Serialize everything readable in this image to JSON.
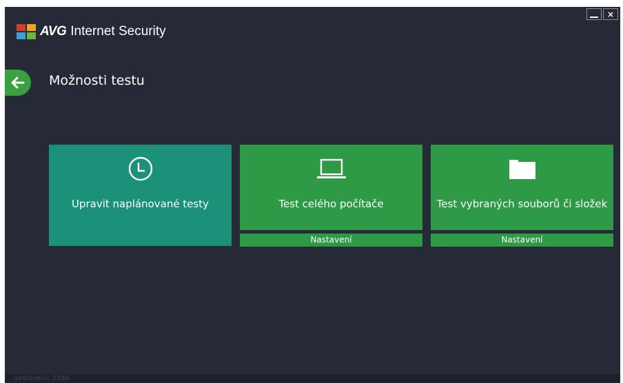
{
  "app": {
    "brand": "AVG",
    "product": "Internet Security"
  },
  "window_controls": {
    "minimize": "_",
    "close": "×"
  },
  "page": {
    "title": "Možnosti testu"
  },
  "tiles": [
    {
      "label": "Upravit naplánované testy",
      "icon": "clock-icon"
    },
    {
      "label": "Test celého počítače",
      "icon": "laptop-icon",
      "settings": "Nastavení"
    },
    {
      "label": "Test vybraných souborů či složek",
      "icon": "folder-icon",
      "settings": "Nastavení"
    }
  ],
  "status_bar": {
    "text": "sestavení: 2586"
  },
  "colors": {
    "background": "#262a36",
    "teal_tile": "#1b917a",
    "green_tile": "#2f9a46"
  }
}
